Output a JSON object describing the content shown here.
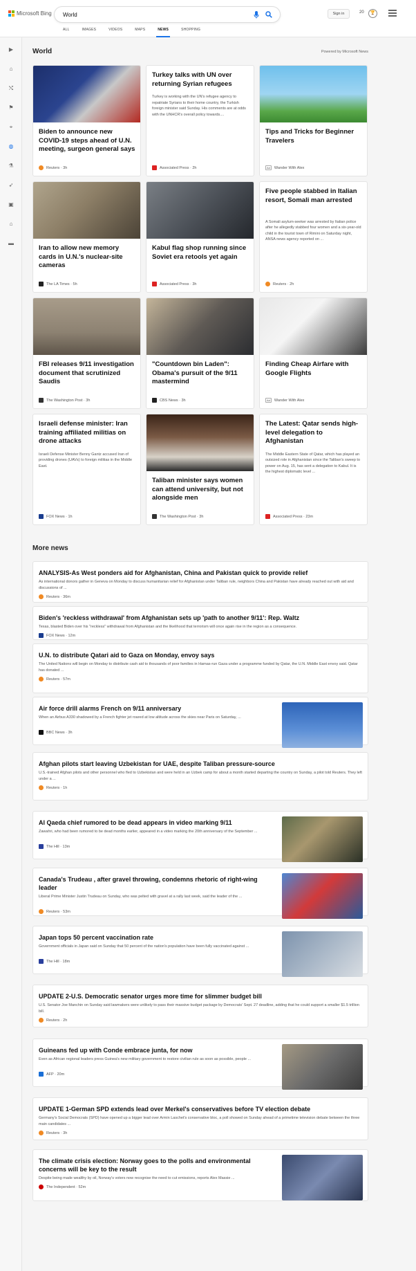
{
  "header": {
    "logo_text": "Microsoft Bing",
    "search_value": "World",
    "signin_label": "Sign in",
    "rewards_count": "20",
    "tabs": [
      "ALL",
      "IMAGES",
      "VIDEOS",
      "MAPS",
      "NEWS",
      "SHOPPING"
    ]
  },
  "colors": {
    "accent": "#1a73e8",
    "logo_red": "#f25022",
    "logo_green": "#7fba00",
    "logo_blue": "#00a4ef",
    "logo_yellow": "#ffb900"
  },
  "sidebar_icons": [
    "expand-icon",
    "home-icon",
    "trending-icon",
    "flag-icon",
    "location-icon",
    "globe-icon",
    "science-icon",
    "rocket-icon",
    "entertainment-icon",
    "bank-icon",
    "money-icon"
  ],
  "world": {
    "title": "World",
    "powered_by": "Powered by Microsoft News",
    "cards": [
      {
        "title": "Biden to announce new COVID-19 steps ahead of U.N. meeting, surgeon general says",
        "snippet": "",
        "source": "Reuters",
        "time": "3h",
        "ad": false,
        "icon": "reuters-icon"
      },
      {
        "title": "Turkey talks with UN over returning Syrian refugees",
        "snippet": "Turkey is working with the UN's refugee agency to repatriate Syrians to their home country, the Turkish foreign minister said Sunday. His comments are at odds with the UNHCR's overall policy towards....",
        "source": "Associated Press",
        "time": "2h",
        "ad": false,
        "icon": "ap-icon"
      },
      {
        "title": "Tips and Tricks for Beginner Travelers",
        "snippet": "",
        "source": "Wander With Alex",
        "time": "",
        "ad": true,
        "ad_label": "Ad",
        "icon": "ad-icon"
      },
      {
        "title": "Iran to allow new memory cards in U.N.'s nuclear-site cameras",
        "snippet": "",
        "source": "The LA Times",
        "time": "5h",
        "ad": false,
        "icon": "latimes-icon"
      },
      {
        "title": "Kabul flag shop running since Soviet era retools yet again",
        "snippet": "",
        "source": "Associated Press",
        "time": "3h",
        "ad": false,
        "icon": "ap-icon"
      },
      {
        "title": "Five people stabbed in Italian resort, Somali man arrested",
        "snippet": "A Somali asylum-seeker was arrested by Italian police after he allegedly stabbed four women and a six-year-old child in the tourist town of Rimini on Saturday night, ANSA news agency reported on ...",
        "source": "Reuters",
        "time": "2h",
        "ad": false,
        "icon": "reuters-icon"
      },
      {
        "title": "FBI releases 9/11 investigation document that scrutinized Saudis",
        "snippet": "",
        "source": "The Washington Post",
        "time": "3h",
        "ad": false,
        "icon": "wapo-icon"
      },
      {
        "title": "\"Countdown bin Laden\": Obama's pursuit of the 9/11 mastermind",
        "snippet": "",
        "source": "CBS News",
        "time": "3h",
        "ad": false,
        "icon": "cbs-icon"
      },
      {
        "title": "Finding Cheap Airfare with Google Flights",
        "snippet": "",
        "source": "Wander With Alex",
        "time": "",
        "ad": true,
        "ad_label": "Ad",
        "icon": "ad-icon"
      },
      {
        "title": "Israeli defense minister: Iran training affiliated militias on drone attacks",
        "snippet": "Israeli Defense Minister Benny Gantz accused Iran of providing drones (UAVs) to foreign militias in the Middle East.",
        "source": "FOX News",
        "time": "1h",
        "ad": false,
        "icon": "fox-icon"
      },
      {
        "title": "Taliban minister says women can attend university, but not alongside men",
        "snippet": "",
        "source": "The Washington Post",
        "time": "3h",
        "ad": false,
        "icon": "wapo-icon"
      },
      {
        "title": "The Latest: Qatar sends high-level delegation to Afghanistan",
        "snippet": "The Middle Eastern State of Qatar, which has played an outsized role in Afghanistan since the Taliban's sweep to power on Aug. 15, has sent a delegation to Kabul. It is the highest diplomatic level ...",
        "source": "Associated Press",
        "time": "23m",
        "ad": false,
        "icon": "ap-icon"
      }
    ]
  },
  "more_news": {
    "title": "More news",
    "items": [
      {
        "title": "ANALYSIS-As West ponders aid for Afghanistan, China and Pakistan quick to provide relief",
        "snippet": "As international donors gather in Geneva on Monday to discuss humanitarian relief for Afghanistan under Taliban rule, neighbors China and Pakistan have already reached out with aid and discussions of ...",
        "source": "Reuters",
        "time": "36m",
        "icon": "reuters-icon",
        "thumb": false
      },
      {
        "title": "Biden's 'reckless withdrawal' from Afghanistan sets up 'path to another 9/11': Rep. Waltz",
        "snippet": "Texas, blasted Biden over his \"reckless\" withdrawal from Afghanistan and the likelihood that terrorism will once again rise in the region as a consequence.",
        "source": "FOX News",
        "time": "12m",
        "icon": "fox-icon",
        "thumb": false
      },
      {
        "title": "U.N. to distribute Qatari aid to Gaza on Monday, envoy says",
        "snippet": "The United Nations will begin on Monday to distribute cash aid to thousands of poor families in Hamas-run Gaza under a programme funded by Qatar, the U.N. Middle East envoy said. Qatar has donated ...",
        "source": "Reuters",
        "time": "57m",
        "icon": "reuters-icon",
        "thumb": false
      },
      {
        "title": "Air force drill alarms French on 9/11 anniversary",
        "snippet": "When an Airbus A330 shadowed by a French fighter jet roared at low altitude across the skies near Paris on Saturday, ...",
        "source": "BBC News",
        "time": "3h",
        "icon": "bbc-icon",
        "thumb": true
      },
      {
        "title": "Afghan pilots start leaving Uzbekistan for UAE, despite Taliban pressure-source",
        "snippet": "U.S.-trained Afghan pilots and other personnel who fled to Uzbekistan and were held in an Uzbek camp for about a month started departing the country on Sunday, a pilot told Reuters. They left under a ...",
        "source": "Reuters",
        "time": "1h",
        "icon": "reuters-icon",
        "thumb": false
      },
      {
        "title": "Al Qaeda chief rumored to be dead appears in video marking 9/11",
        "snippet": "Zawahri, who had been rumored to be dead months earlier, appeared in a video marking the 20th anniversary of the September ...",
        "source": "The Hill",
        "time": "13m",
        "icon": "hill-icon",
        "thumb": true
      },
      {
        "title": "Canada's Trudeau , after gravel throwing, condemns rhetoric of right-wing leader",
        "snippet": "Liberal Prime Minister Justin Trudeau on Sunday, who was pelted with gravel at a rally last week, said the leader of the ...",
        "source": "Reuters",
        "time": "53m",
        "icon": "reuters-icon",
        "thumb": true
      },
      {
        "title": "Japan tops 50 percent vaccination rate",
        "snippet": "Government officials in Japan said on Sunday that 50 percent of the nation's population have been fully vaccinated against ...",
        "source": "The Hill",
        "time": "18m",
        "icon": "hill-icon",
        "thumb": true
      },
      {
        "title": "UPDATE 2-U.S. Democratic senator urges more time for slimmer budget bill",
        "snippet": "U.S. Senator Joe Manchin on Sunday said lawmakers were unlikely to pass their massive budget package by Democrats' Sept. 27 deadline, adding that he could support a smaller $1.5 trillion bill.",
        "source": "Reuters",
        "time": "2h",
        "icon": "reuters-icon",
        "thumb": false
      },
      {
        "title": "Guineans fed up with Conde embrace junta, for now",
        "snippet": "Even as African regional leaders press Guinea's new military government to restore civilian rule as soon as possible, people ...",
        "source": "AFP",
        "time": "20m",
        "icon": "afp-icon",
        "thumb": true
      },
      {
        "title": "UPDATE 1-German SPD extends lead over Merkel's conservatives before TV election debate",
        "snippet": "Germany's Social Democrats (SPD) have opened up a bigger lead over Armin Laschet's conservative bloc, a poll showed on Sunday ahead of a primetime television debate between the three main candidates ...",
        "source": "Reuters",
        "time": "3h",
        "icon": "reuters-icon",
        "thumb": false
      },
      {
        "title": "The climate crisis election: Norway goes to the polls and environmental concerns will be key to the result",
        "snippet": "Despite being made wealthy by oil, Norway's voters now recognise the need to cut emissions, reports Alex Massie ...",
        "source": "The Independent",
        "time": "52m",
        "icon": "independent-icon",
        "thumb": true
      }
    ]
  }
}
